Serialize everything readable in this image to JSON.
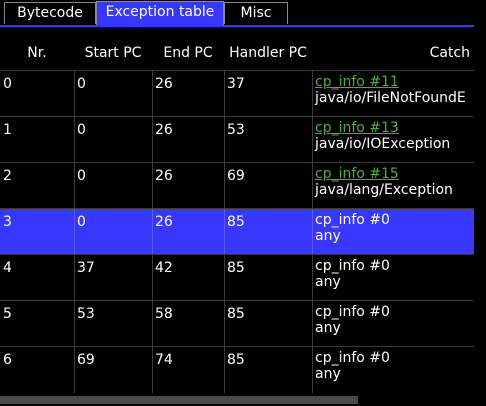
{
  "tabs": [
    {
      "label": "Bytecode",
      "active": false
    },
    {
      "label": "Exception table",
      "active": true
    },
    {
      "label": "Misc",
      "active": false
    }
  ],
  "columns": [
    "Nr.",
    "Start PC",
    "End PC",
    "Handler PC",
    "Catch"
  ],
  "rows": [
    {
      "nr": "0",
      "start_pc": "0",
      "end_pc": "26",
      "handler_pc": "37",
      "catch_ref": "cp_info #11",
      "catch_type": "java/io/FileNotFoundE",
      "linked": true,
      "selected": false
    },
    {
      "nr": "1",
      "start_pc": "0",
      "end_pc": "26",
      "handler_pc": "53",
      "catch_ref": "cp_info #13",
      "catch_type": "java/io/IOException",
      "linked": true,
      "selected": false
    },
    {
      "nr": "2",
      "start_pc": "0",
      "end_pc": "26",
      "handler_pc": "69",
      "catch_ref": "cp_info #15",
      "catch_type": "java/lang/Exception",
      "linked": true,
      "selected": false
    },
    {
      "nr": "3",
      "start_pc": "0",
      "end_pc": "26",
      "handler_pc": "85",
      "catch_ref": "cp_info #0",
      "catch_type": "any",
      "linked": false,
      "selected": true
    },
    {
      "nr": "4",
      "start_pc": "37",
      "end_pc": "42",
      "handler_pc": "85",
      "catch_ref": "cp_info #0",
      "catch_type": "any",
      "linked": false,
      "selected": false
    },
    {
      "nr": "5",
      "start_pc": "53",
      "end_pc": "58",
      "handler_pc": "85",
      "catch_ref": "cp_info #0",
      "catch_type": "any",
      "linked": false,
      "selected": false
    },
    {
      "nr": "6",
      "start_pc": "69",
      "end_pc": "74",
      "handler_pc": "85",
      "catch_ref": "cp_info #0",
      "catch_type": "any",
      "linked": false,
      "selected": false
    }
  ],
  "colors": {
    "background": "#000000",
    "selection": "#3737ff",
    "link": "#4caf3a",
    "gridline": "#3a3a3a"
  }
}
